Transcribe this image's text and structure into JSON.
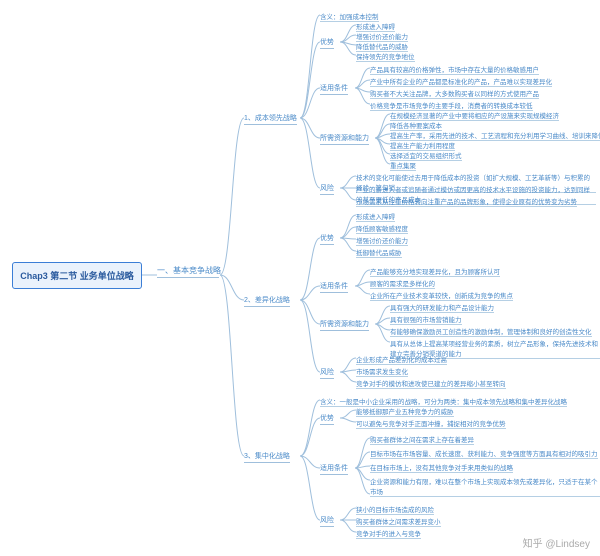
{
  "root": "Chap3 第二节 业务单位战略",
  "level1": "一、基本竞争战略",
  "strategies": {
    "s1": {
      "name": "1、成本领先战略",
      "def": "含义：加强成本控制",
      "adv": [
        "形成进入障碍",
        "增强讨价还价能力",
        "降低替代品的威胁",
        "保持领先的竞争地位"
      ],
      "cond": [
        "产品具有较高的价格弹性，市场中存在大量的价格敏感用户",
        "产业中所有企业的产品都是标准化的产品，产品难以实现差异化",
        "购买者不大关注品牌，大多数购买者以同样的方式使用产品",
        "价格竞争是市场竞争的主要手段，消费者的转换成本较低"
      ],
      "res": [
        "在规模经济显著的产业中要将相应的产设施来实现规模经济",
        "降低各种要案成本",
        "提高生产率，采用先进的技术、工艺流程和充分利用学习曲线、培训来降低成本",
        "提高生产能力利用程度",
        "选择适宜的交易组织形式",
        "重点集聚"
      ],
      "risk": [
        "技术的变化可能使过去用于降低成本的投资（如扩大规模、工艺革新等）与积累的经验一笔勾销",
        "产业的新进入者或追随者通过模仿或因更高的技术水平设施的投资能力，达到同样的甚至更低的产品成本",
        "市场需求从注重价格转向注重产品的品牌形象，使得企业原有的优势变为劣势"
      ]
    },
    "s2": {
      "name": "2、差异化战略",
      "adv": [
        "形成进入障碍",
        "降低顾客敏感程度",
        "增强讨价还价能力",
        "抵御替代品威胁"
      ],
      "cond": [
        "产品能够充分地实现差异化，且为顾客所认可",
        "顾客的需求是多样化的",
        "企业所在产业技术变革较快，创新成为竞争的焦点"
      ],
      "res": [
        "具有强大的研发能力和产品设计能力",
        "具有很强的市场营销能力",
        "有能够确保激励员工创造性的激励体制，管理体制和良好的创造性文化",
        "具有从总体上提高某项经营业务的素质，树立产品形象，保持先进技术和建立完善分销渠道的能力"
      ],
      "risk": [
        "企业形成产品差别化的成本过高",
        "市场需求发生变化",
        "竞争对手的模仿和进攻使已建立的差异缩小甚至转向"
      ]
    },
    "s3": {
      "name": "3、集中化战略",
      "def": "含义：一般是中小企业采用的战略，可分为两类：集中成本领先战略和集中差异化战略",
      "adv": [
        "能够抵御那产业五种竞争力的威胁",
        "可以避免与竞争对手正面冲撞，捕捉相对的竞争优势"
      ],
      "cond": [
        "购买者群体之间在需求上存在着差异",
        "目标市场在市场容量、成长速度、获利能力、竞争强度等方面具有相对的吸引力",
        "在目标市场上，没有其他竞争对手来用类似的战略",
        "企业资源和能力有限，难以在整个市场上实现成本领先或差异化，只适于在某个市场"
      ],
      "risk": [
        "狭小的目标市场造成的风险",
        "购买者群体之间需求差异变小",
        "竞争对手的进入与竞争"
      ]
    }
  },
  "watermark": "知乎 @Lindsey"
}
